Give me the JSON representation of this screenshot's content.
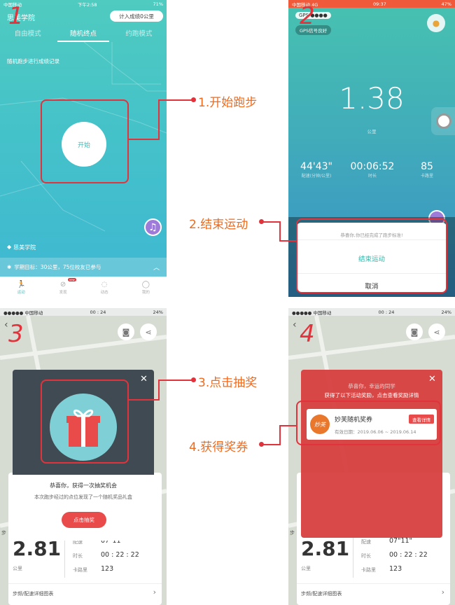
{
  "p1": {
    "status_carrier": "中国移动",
    "status_time": "下午2:58",
    "status_batt": "71%",
    "school": "思美学院",
    "count_btn": "计入成绩0公里",
    "tabs": [
      "自由模式",
      "随机终点",
      "约跑模式"
    ],
    "record_text": "随机跑步进行成绩记录",
    "start_label": "开始",
    "location": "思美学院",
    "goal": "学期目标：30公里，75位校友已参与",
    "nav": [
      "运动",
      "发现",
      "动态",
      "我的"
    ],
    "nav_badge": "new",
    "step": "1"
  },
  "p2": {
    "status_carrier": "中国移动",
    "status_net": "4G",
    "status_time": "09:37",
    "status_batt": "47%",
    "gps": "GPS",
    "gps_text": "GPS信号良好",
    "distance": "1.38",
    "dist_unit": "公里",
    "stats": [
      {
        "v": "44'43\"",
        "l": "配速(分钟/公里)"
      },
      {
        "v": "00:06:52",
        "l": "时长"
      },
      {
        "v": "85",
        "l": "卡路里"
      }
    ],
    "msg": "恭喜你,你已经完成了跑步标准!",
    "end_btn": "结束运动",
    "cancel_btn": "取消",
    "step": "2"
  },
  "p3": {
    "status_carrier": "●●●●● 中国移动",
    "status_time": "00 : 24",
    "status_batt": "24%",
    "title": "恭喜你，获得一次抽奖机会",
    "desc": "本次跑步经过的点位发现了一个随机奖品礼盒",
    "draw_btn": "点击抽奖",
    "dist": "2.81",
    "dist_unit": "公里",
    "pace_l": "配速",
    "pace": "07\"11\"",
    "dur_l": "时长",
    "dur": "00 : 22 : 22",
    "cal_l": "卡路里",
    "cal": "123",
    "detail": "步频/配速详细图表",
    "step": "3",
    "map_label": "步"
  },
  "p4": {
    "status_carrier": "●●●●● 中国移动",
    "status_time": "00 : 24",
    "status_batt": "24%",
    "line1": "恭喜你，幸运的同学",
    "line2": "获得了以下活动奖励，点击查看奖励详情",
    "coupon_logo": "妙芙",
    "coupon_title": "妙芙随机奖券",
    "coupon_date": "有效日期：2019.06.06 ~ 2019.06.14",
    "view_btn": "查看详情",
    "dist": "2.81",
    "dist_unit": "公里",
    "pace_l": "配速",
    "pace": "07\"11\"",
    "dur_l": "时长",
    "dur": "00 : 22 : 22",
    "cal_l": "卡路里",
    "cal": "123",
    "detail": "步频/配速详细图表",
    "step": "4",
    "map_label": "步"
  },
  "annotations": {
    "a1": "1.开始跑步",
    "a2": "2.结束运动",
    "a3": "3.点击抽奖",
    "a4": "4.获得奖券"
  },
  "colors": {
    "red": "#e2333c",
    "orange": "#ee6b1e",
    "teal": "#45c3c8"
  }
}
